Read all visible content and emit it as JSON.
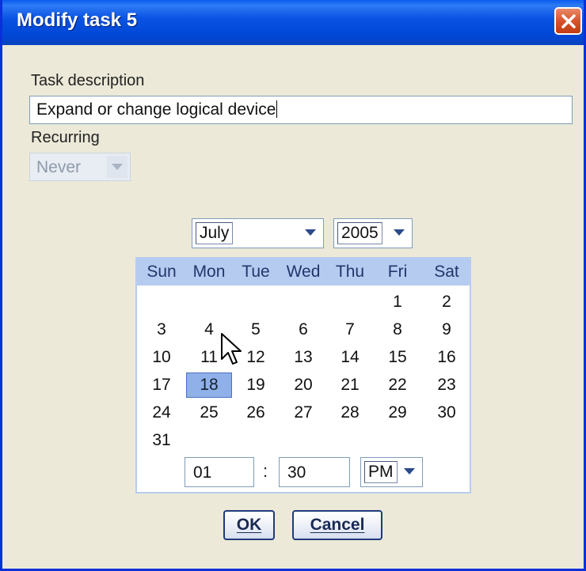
{
  "window": {
    "title": "Modify task 5"
  },
  "form": {
    "description_label": "Task description",
    "description_value": "Expand or change logical device",
    "recurring_label": "Recurring",
    "recurring_value": "Never",
    "recurring_enabled": false
  },
  "calendar": {
    "month": "July",
    "year": "2005",
    "weekdays": [
      "Sun",
      "Mon",
      "Tue",
      "Wed",
      "Thu",
      "Fri",
      "Sat"
    ],
    "weeks": [
      [
        "",
        "",
        "",
        "",
        "",
        "1",
        "2"
      ],
      [
        "3",
        "4",
        "5",
        "6",
        "7",
        "8",
        "9"
      ],
      [
        "10",
        "11",
        "12",
        "13",
        "14",
        "15",
        "16"
      ],
      [
        "17",
        "18",
        "19",
        "20",
        "21",
        "22",
        "23"
      ],
      [
        "24",
        "25",
        "26",
        "27",
        "28",
        "29",
        "30"
      ],
      [
        "31",
        "",
        "",
        "",
        "",
        "",
        ""
      ]
    ],
    "selected_day": "18"
  },
  "time": {
    "hour": "01",
    "separator": ":",
    "minute": "30",
    "ampm": "PM"
  },
  "buttons": {
    "ok": "OK",
    "cancel": "Cancel"
  },
  "colors": {
    "title_bar": "#0054e3",
    "close_button": "#d9532c",
    "calendar_header": "#b6cbf0",
    "selected_day": "#8fb0e8"
  }
}
